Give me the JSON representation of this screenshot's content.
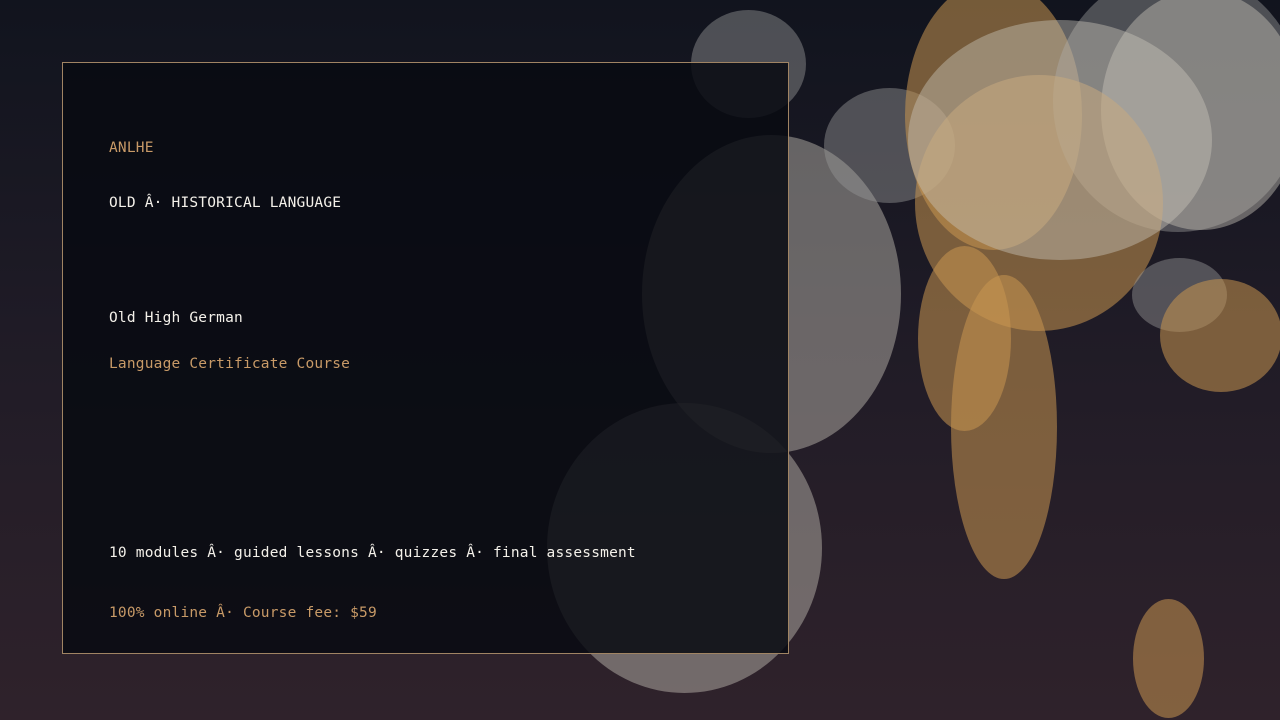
{
  "card": {
    "brand": "ANLHE",
    "category": "OLD Â· HISTORICAL LANGUAGE",
    "title": "Old High German",
    "subtitle": "Language Certificate Course",
    "features": "10 modules Â· guided lessons Â· quizzes Â· final assessment",
    "pricing": "100% online Â· Course fee: $59"
  },
  "colors": {
    "accent": "#c89a67",
    "text": "#f4f1ea",
    "card_border": "#a08463",
    "card_background": "#080b11"
  }
}
